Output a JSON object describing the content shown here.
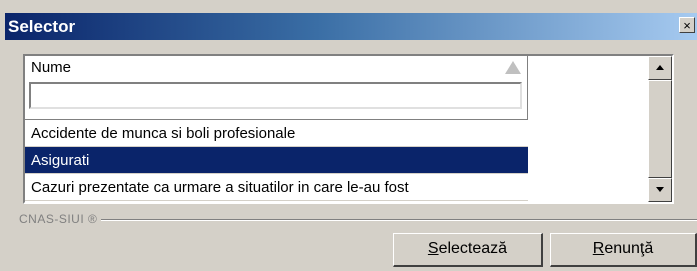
{
  "window": {
    "title": "Selector",
    "close_glyph": "×"
  },
  "grid": {
    "column_header": "Nume",
    "filter_value": "",
    "rows": [
      {
        "label": "Accidente de munca si boli profesionale",
        "selected": false
      },
      {
        "label": "Asigurati",
        "selected": true
      },
      {
        "label": "Cazuri prezentate ca urmare a situatilor in care le-au fost",
        "selected": false
      }
    ],
    "sort_icon": "sort-ascending-icon",
    "scroll_up_icon": "arrow-up-icon",
    "scroll_down_icon": "arrow-down-icon"
  },
  "footer": {
    "brand": "CNAS-SIUI ®"
  },
  "buttons": {
    "select_accel": "S",
    "select_rest": "electează",
    "cancel_accel": "R",
    "cancel_rest": "enunţă"
  },
  "colors": {
    "title_start": "#0a246a",
    "title_end": "#a6caf0",
    "selection": "#0a246a",
    "face": "#d4d0c8"
  }
}
